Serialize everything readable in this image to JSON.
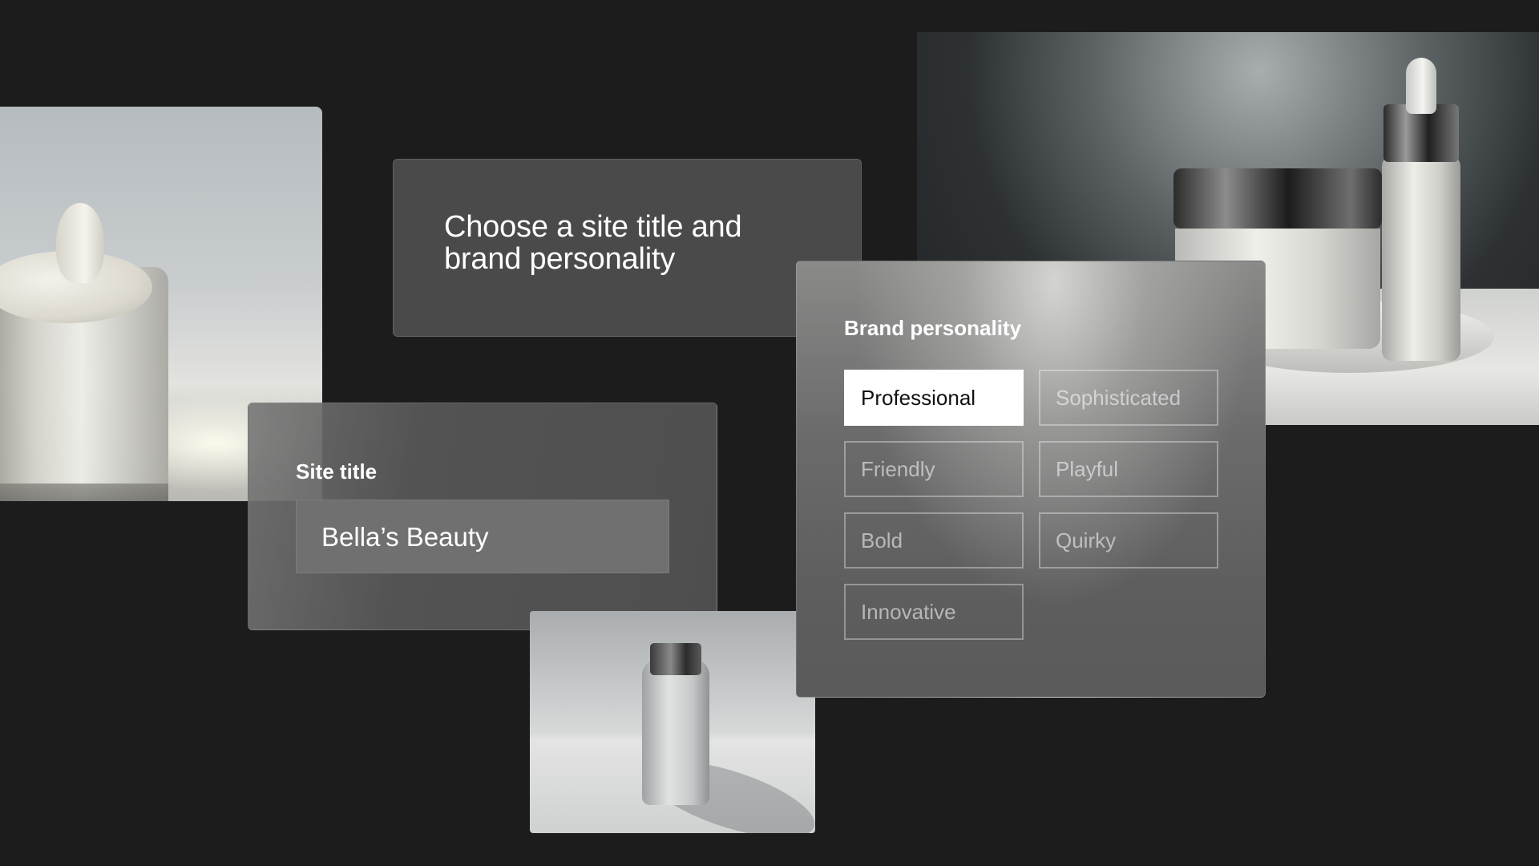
{
  "heading": {
    "title": "Choose a site title and brand personality"
  },
  "site_title": {
    "label": "Site title",
    "value": "Bella’s Beauty"
  },
  "brand_personality": {
    "label": "Brand personality",
    "options": [
      {
        "label": "Professional",
        "selected": true
      },
      {
        "label": "Sophisticated",
        "selected": false
      },
      {
        "label": "Friendly",
        "selected": false
      },
      {
        "label": "Playful",
        "selected": false
      },
      {
        "label": "Bold",
        "selected": false
      },
      {
        "label": "Quirky",
        "selected": false
      },
      {
        "label": "Innovative",
        "selected": false
      }
    ]
  },
  "colors": {
    "background": "#1c1c1c",
    "card": "#4a4a4a",
    "selected_chip": "#ffffff",
    "text": "#ffffff"
  }
}
